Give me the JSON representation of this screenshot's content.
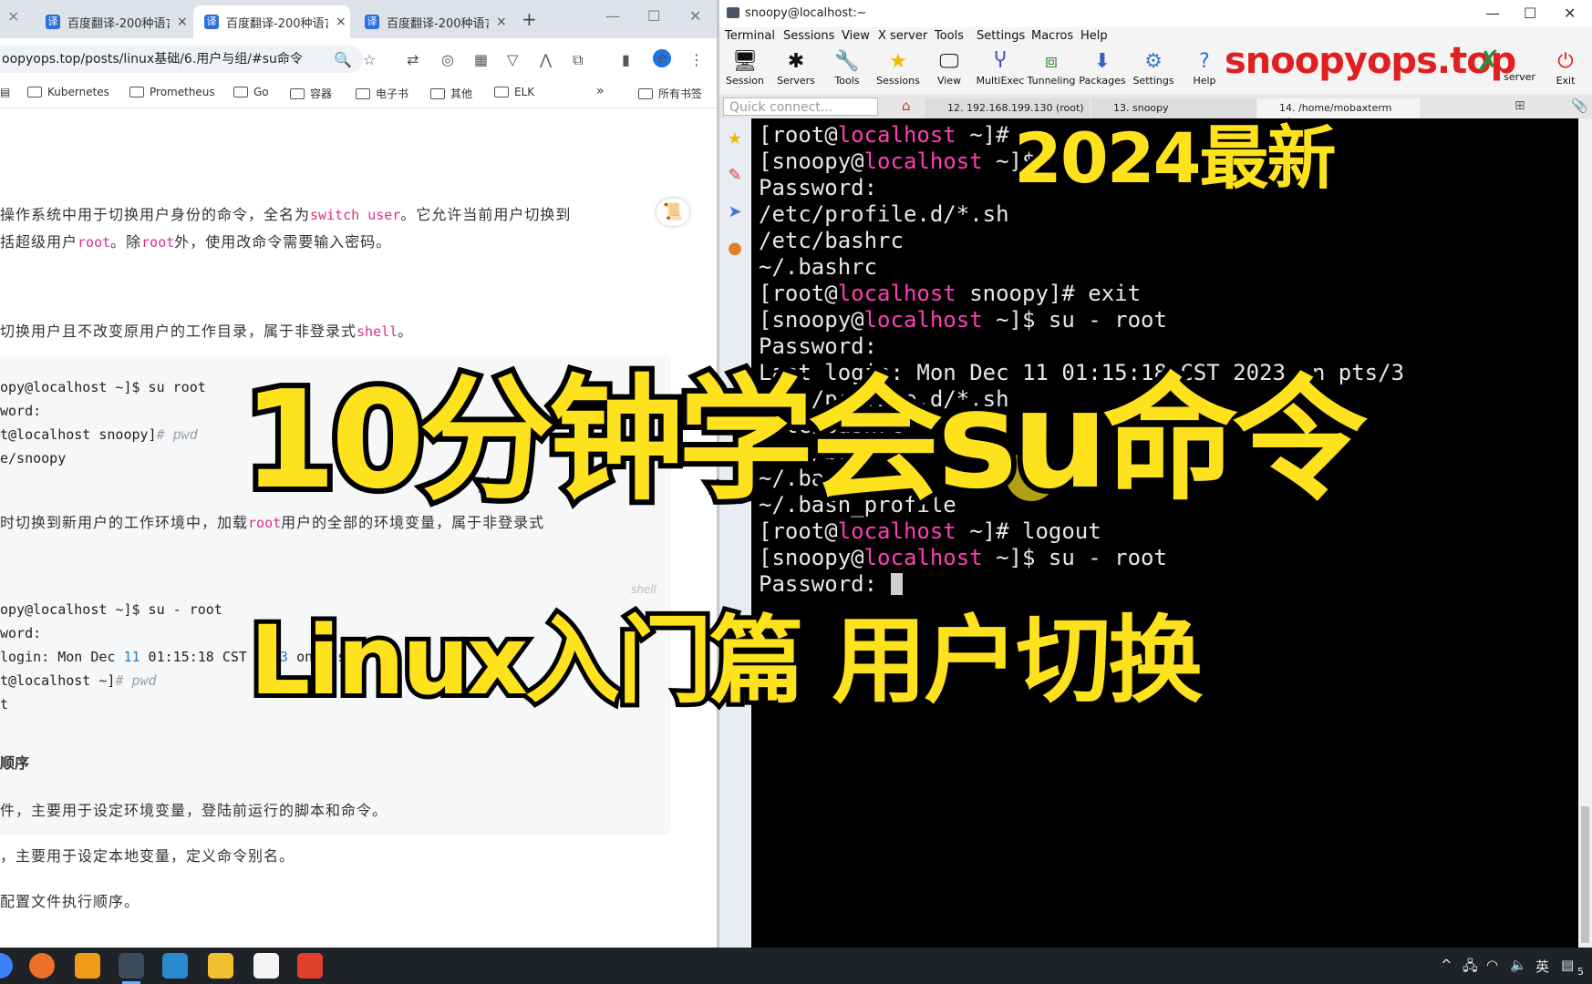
{
  "browser": {
    "tabs": [
      {
        "label": "百度翻译-200种语言"
      },
      {
        "label": "百度翻译-200种语言"
      },
      {
        "label": "百度翻译-200种语言"
      }
    ],
    "tab_close": "×",
    "new_tab": "+",
    "url": "oopyops.top/posts/linux基础/6.用户与组/#su命令",
    "bookmarks": [
      "Kubernetes",
      "Prometheus",
      "Go",
      "容器",
      "电子书",
      "其他",
      "ELK"
    ],
    "bookmarks_more": "»",
    "all_bookmarks": "所有书签",
    "ext_label": "e"
  },
  "article": {
    "p1_a": "操作系统中用于切换用户身份的命令，全名为",
    "p1_code": "switch user",
    "p1_b": "。它允许当前用户切换到",
    "p2_a": "括超级用户",
    "p2_code1": "root",
    "p2_b": "。除",
    "p2_code2": "root",
    "p2_c": "外，使用改命令需要输入密码。",
    "p3_a": "切换用户且不改变原用户的工作目录，属于非登录式",
    "p3_code": "shell",
    "p3_b": "。",
    "code1": [
      {
        "text": "opy@localhost ~]$ su root"
      },
      {
        "text": "word:"
      },
      {
        "text": "t@localhost snoopy]",
        "comment": "# pwd"
      },
      {
        "text": "e/snoopy"
      }
    ],
    "p4_a": "时切换到新用户的工作环境中，加载",
    "p4_code": "root",
    "p4_b": "用户的全部的环境变量，属于非登录式",
    "code2": [
      {
        "text": "opy@localhost ~]$ su - root"
      },
      {
        "text": "word:"
      },
      {
        "text": " login: Mon Dec ",
        "num": "11",
        "text2": " 01:15:18 CST ",
        "num2": "2023",
        "text3": " on pts/3"
      },
      {
        "text": "t@localhost ~]",
        "comment": "# pwd"
      },
      {
        "text": "t"
      }
    ],
    "shell_label": "shell",
    "heading": "顺序",
    "p5": "件，主要用于设定环境变量，登陆前运行的脚本和命令。",
    "p6": "，主要用于设定本地变量，定义命令别名。",
    "p7": "配置文件执行顺序。"
  },
  "moba": {
    "title": "snoopy@localhost:~",
    "menu": [
      "Terminal",
      "Sessions",
      "View",
      "X server",
      "Tools",
      "Settings",
      "Macros",
      "Help"
    ],
    "tools": [
      "Session",
      "Servers",
      "Tools",
      "Sessions",
      "View",
      "MultiExec",
      "Tunneling",
      "Packages",
      "Settings",
      "Help"
    ],
    "xserver": "X server",
    "exit": "Exit",
    "brand": "snoopyops.top",
    "quick_connect": "Quick connect...",
    "session_tabs": [
      "12. 192.168.199.130 (root)",
      "13. snoopy",
      "14. /home/mobaxterm"
    ]
  },
  "terminal": {
    "lines": [
      {
        "pre": "[root@",
        "host": "localhost",
        "post": " ~]#"
      },
      {
        "pre": "[snoopy@",
        "host": "localhost",
        "post": " ~]$"
      },
      {
        "pre": "Password:"
      },
      {
        "pre": "/etc/profile.d/*.sh"
      },
      {
        "pre": "/etc/bashrc"
      },
      {
        "pre": "~/.bashrc"
      },
      {
        "pre": "[root@",
        "host": "localhost",
        "post": " snoopy]# exit"
      },
      {
        "pre": "[snoopy@",
        "host": "localhost",
        "post": " ~]$ su - root"
      },
      {
        "pre": "Password:"
      },
      {
        "pre": "Last login: Mon Dec 11 01:15:18 CST 2023 on pts/3"
      },
      {
        "pre": "/etc/profile.d/*.sh"
      },
      {
        "pre": "/etc/bashrc"
      },
      {
        "pre": "/etc/bashrc"
      },
      {
        "pre": "~/.bashrc"
      },
      {
        "pre": "~/.bash_profile"
      },
      {
        "pre": "[root@",
        "host": "localhost",
        "post": " ~]# logout"
      },
      {
        "pre": "[snoopy@",
        "host": "localhost",
        "post": " ~]$ su - root"
      },
      {
        "pre": "Password: "
      }
    ]
  },
  "overlay": {
    "year": "2024最新",
    "main": "10分钟学会su命令",
    "sub": "Linux入门篇  用户切换"
  },
  "taskbar": {
    "ime": "英",
    "notif_count": "5"
  },
  "colors": {
    "overlay_fill": "#ffe21e",
    "host_pink": "#ff3fb5",
    "brand_red": "#e02020",
    "terminal_bg": "#000000"
  }
}
